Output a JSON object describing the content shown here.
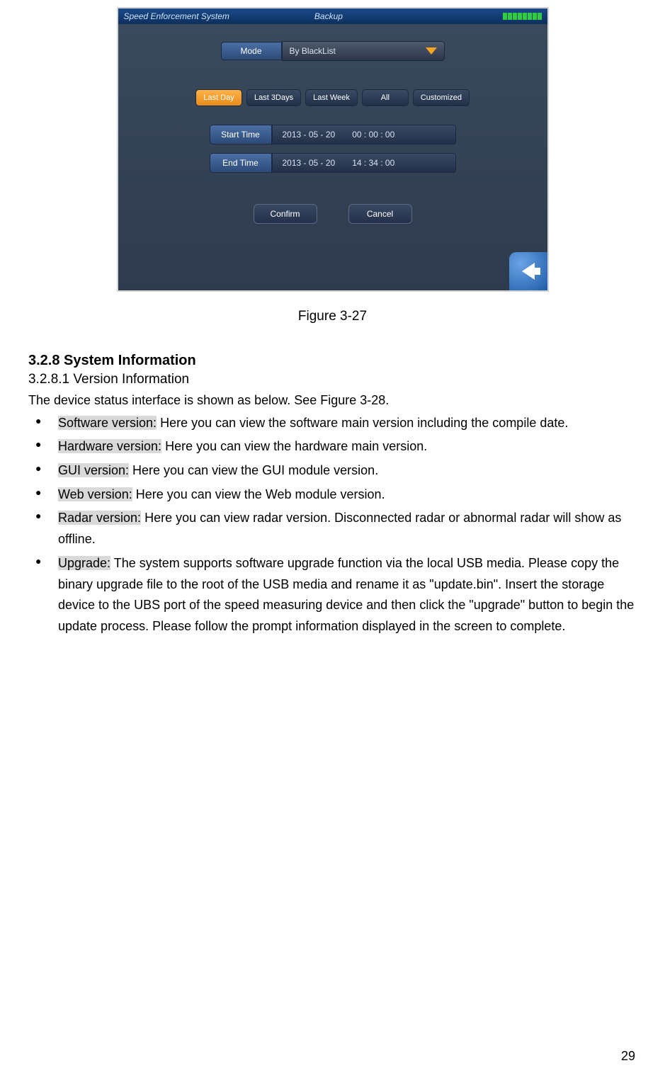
{
  "screenshot": {
    "app_title": "Speed Enforcement System",
    "page_tab": "Backup",
    "mode_label": "Mode",
    "mode_value": "By BlackList",
    "range": {
      "active": "Last Day",
      "b1": "Last 3Days",
      "b2": "Last Week",
      "b3": "All",
      "b4": "Customized"
    },
    "start_label": "Start Time",
    "start_date": "2013 - 05 - 20",
    "start_time": "00 : 00 : 00",
    "end_label": "End Time",
    "end_date": "2013 - 05 - 20",
    "end_time": "14 : 34 : 00",
    "confirm": "Confirm",
    "cancel": "Cancel"
  },
  "fig_caption": "Figure 3-27",
  "h1": "3.2.8   System Information",
  "h2": "3.2.8.1  Version Information",
  "intro": "The device status interface is shown as below. See Figure 3-28.",
  "bullets": {
    "b1_hl": "Software version:",
    "b1_txt": " Here you can view the software main version including the compile date.",
    "b2_hl": "Hardware version:",
    "b2_txt": " Here you can view the hardware main version.",
    "b3_hl": "GUI version:",
    "b3_txt": " Here you can view the GUI module version.",
    "b4_hl": "Web version:",
    "b4_txt": " Here you can view the Web module version.",
    "b5_hl": "Radar version:",
    "b5_txt": " Here you can view radar version.  Disconnected radar or abnormal radar will show as offline.",
    "b6_hl": "Upgrade:",
    "b6_txt": " The system supports software upgrade function via the local USB media. Please copy the binary upgrade file to the root of the USB media and rename it as \"update.bin\". Insert the storage device to the UBS port of the speed measuring device and then click the \"upgrade\" button to begin the update process. Please follow the prompt information displayed in the screen to complete."
  },
  "page_num": "29"
}
